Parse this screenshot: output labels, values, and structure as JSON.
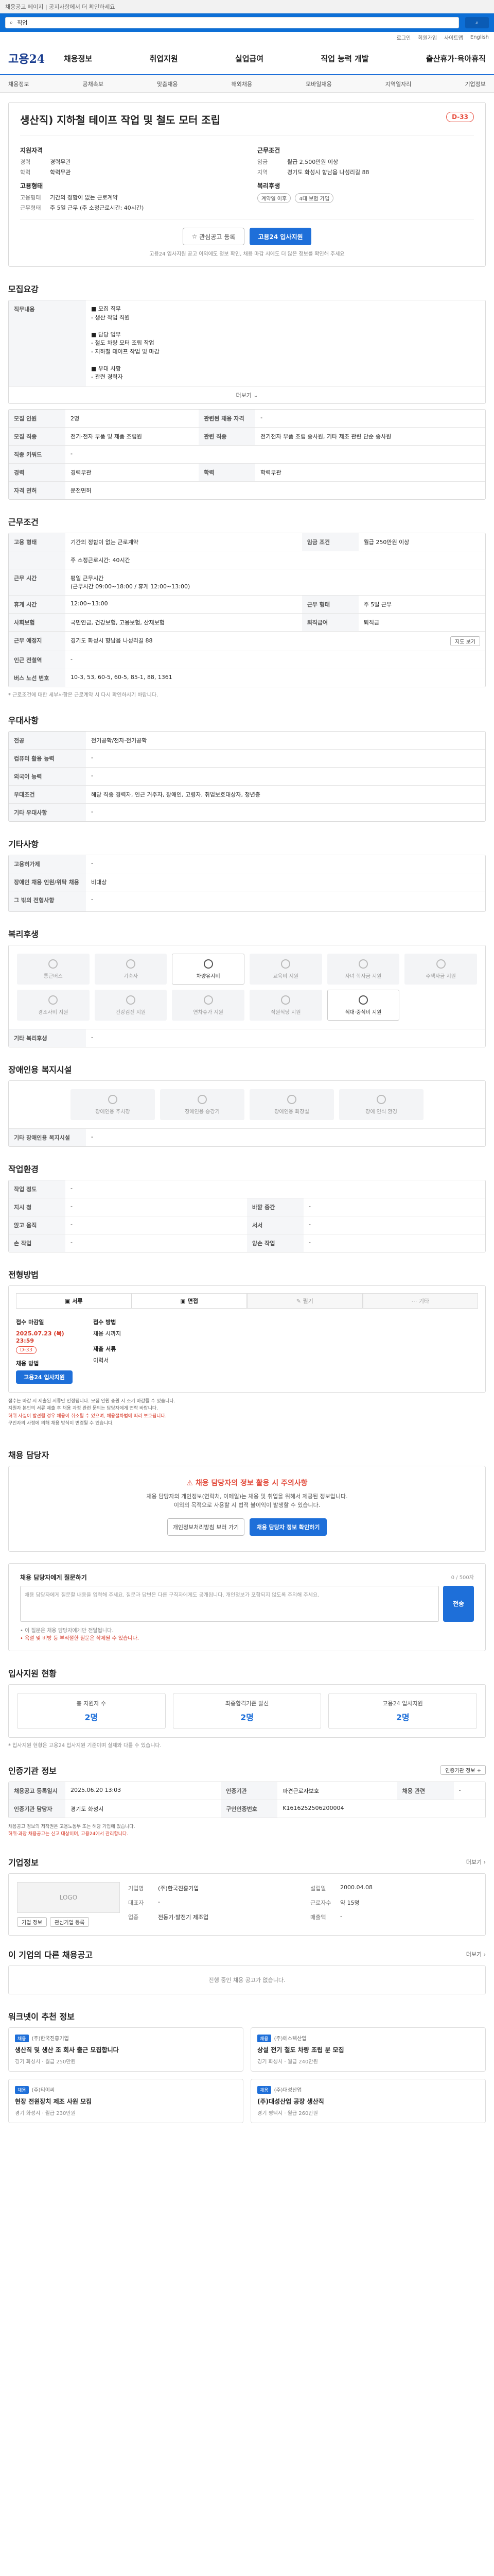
{
  "top": {
    "notice": "채용공고 페이지 | 공지사항에서 더 확인하세요"
  },
  "search": {
    "value": "직업"
  },
  "subnav": [
    "로그인",
    "회원가입",
    "사이트맵",
    "English"
  ],
  "logo": "고용24",
  "gnb": [
    "채용정보",
    "취업지원",
    "실업급여",
    "직업 능력 개발",
    "출산휴가·육아휴직"
  ],
  "lnb": [
    "채용정보",
    "공채속보",
    "맞춤채용",
    "해외채용",
    "모바일채용",
    "지역일자리",
    "기업정보"
  ],
  "job": {
    "title": "생산직) 지하철 테이프 작업 및 철도 모터 조립",
    "dday": "D-33",
    "left": {
      "title": "지원자격",
      "rows": [
        [
          "경력",
          "경력무관"
        ],
        [
          "학력",
          "학력무관"
        ]
      ],
      "title2": "고용형태",
      "rows2": [
        [
          "고용형태",
          "기간의 정함이 없는 근로계약"
        ],
        [
          "근무형태",
          "주 5일 근무 (주 소정근로시간: 40시간)"
        ]
      ]
    },
    "right": {
      "title": "근무조건",
      "rows": [
        [
          "임금",
          "월급 2,500만원 이상"
        ],
        [
          "지역",
          "경기도 화성시 향남읍 나성리길 88"
        ]
      ],
      "title2": "복리후생",
      "tags": [
        "계약일 이후",
        "4대 보험 가입"
      ]
    },
    "btn_interest": "관심공고 등록",
    "btn_apply": "고용24 입사지원",
    "note": "고용24 입사지원 공고 이외에도 정보 확인, 채용 마감 시에도 더 많은 정보를 확인해 주세요"
  },
  "apply": {
    "heading": "모집요강",
    "rows": [
      [
        "직무내용",
        "■ 모집 직무\n- 생산 작업 직원\n\n■ 담당 업무\n- 철도 차량 모터 조립 작업\n- 지하철 테이프 작업 및 마감\n\n■ 우대 사항\n- 관련 경력자"
      ]
    ],
    "more": "더보기",
    "grid": [
      [
        "모집 인원",
        "2명",
        "관련된 채용 자격",
        "-"
      ],
      [
        "모집 직종",
        "전기·전자 부품 및 제품 조립원",
        "관련 직종",
        "전기전자 부품 조립 종사원, 기타 제조 관련 단순 종사원"
      ],
      [
        "직종 키워드",
        "-",
        "",
        ""
      ],
      [
        "경력",
        "경력무관",
        "학력",
        "학력무관"
      ],
      [
        "자격 면허",
        "운전면허",
        "",
        ""
      ]
    ]
  },
  "work": {
    "heading": "근무조건",
    "rows": [
      [
        "고용 형태",
        "기간의 정함이 없는 근로계약",
        "임금 조건",
        "월급 250만원 이상"
      ],
      [
        "",
        "주 소정근로시간: 40시간",
        "",
        ""
      ],
      [
        "근무 시간",
        "평일 근무시간\n(근무시간 09:00~18:00 / 휴게 12:00~13:00)",
        "",
        ""
      ],
      [
        "휴게 시간",
        "12:00~13:00",
        "근무 형태",
        "주 5일 근무"
      ],
      [
        "사회보험",
        "국민연금, 건강보험, 고용보험, 산재보험",
        "퇴직급여",
        "퇴직금"
      ],
      [
        "근무 예정지",
        "경기도 화성시 향남읍 나성리길 88",
        "",
        ""
      ],
      [
        "인근 전철역",
        "-",
        "",
        ""
      ],
      [
        "버스 노선 번호",
        "10-3, 53, 60-5, 60-5, 85-1, 88, 1361",
        "",
        ""
      ]
    ],
    "map_btn": "지도 보기",
    "note": "* 근로조건에 대한 세부사항은 근로계약 시 다시 확인하시기 바랍니다."
  },
  "prefer": {
    "heading": "우대사항",
    "rows": [
      [
        "전공",
        "전기공학/전자·전기공학"
      ],
      [
        "컴퓨터 활용 능력",
        "-"
      ],
      [
        "외국어 능력",
        "-"
      ],
      [
        "우대조건",
        "해당 직종 경력자, 인근 거주자, 장애인, 고령자, 취업보호대상자, 청년층"
      ],
      [
        "기타 우대사항",
        "-"
      ]
    ]
  },
  "etc": {
    "heading": "기타사항",
    "rows": [
      [
        "고용허가제",
        "-"
      ],
      [
        "장애인 채용 인원/위탁 채용",
        "비대상"
      ],
      [
        "그 밖의 전형사항",
        "-"
      ]
    ]
  },
  "welfare": {
    "heading": "복리후생",
    "items": [
      "통근버스",
      "기숙사",
      "차량유지비",
      "교육비 지원",
      "자녀 학자금 지원",
      "주택자금 지원",
      "경조사비 지원",
      "건강검진 지원",
      "연차휴가 지원",
      "직원식당 지원",
      "식대·중식비 지원"
    ],
    "active": [
      2,
      10
    ],
    "other_label": "기타 복리후생",
    "other": "-"
  },
  "disabled": {
    "heading": "장애인용 복지시설",
    "items": [
      "장애인용 주차장",
      "장애인용 승강기",
      "장애인용 화장실",
      "장애 인식 환경"
    ],
    "other_label": "기타 장애인용 복지시설",
    "other": "-"
  },
  "env": {
    "heading": "작업환경",
    "rows": [
      [
        "작업 정도",
        "-",
        "",
        ""
      ],
      [
        "지시 청",
        "-",
        "바깥 중간",
        "-"
      ],
      [
        "앉고 움직",
        "-",
        "서서",
        "-"
      ],
      [
        "손 작업",
        "-",
        "양손 작업",
        "-"
      ]
    ]
  },
  "screen": {
    "heading": "전형방법",
    "steps": [
      "서류",
      "면접",
      "필기",
      "기타"
    ],
    "deadline_label": "접수 마감일",
    "deadline": "2025.07.23 (목) 23:59",
    "dday": "D-33",
    "apply_label": "채용 방법",
    "apply_btn": "고용24 입사지원",
    "method_label": "접수 방법",
    "method": "채용 시까지",
    "docs_label": "제출 서류",
    "docs": "이력서",
    "notes": [
      "접수는 마감 시 제출된 서류만 인정됩니다. 모집 인원 충원 시 조기 마감될 수 있습니다.",
      "지원자 본인의 서류 제출 후 채용 과정 관련 문의는 담당자에게 연락 바랍니다.",
      "허위 사실이 발견될 경우 채용이 취소될 수 있으며, 채용절차법에 따라 보호됩니다.",
      "구인자의 사정에 의해 채용 방식이 변경될 수 있습니다."
    ]
  },
  "contact": {
    "heading": "채용 담당자",
    "warn_title": "채용 담당자의 정보 활용 시 주의사항",
    "warn_body": "채용 담당자의 개인정보(연락처, 이메일)는 채용 및 취업을 위해서 제공된 정보입니다.\n이외의 목적으로 사용할 시 법적 불이익이 발생할 수 있습니다.",
    "btn1": "개인정보처리방침 보러 가기",
    "btn2": "채용 담당자 정보 확인하기"
  },
  "ask": {
    "heading": "채용 담당자에게 질문하기",
    "hint": "0 / 500자",
    "placeholder": "채용 담당자에게 질문할 내용을 입력해 주세요. 질문과 답변은 다른 구직자에게도 공개됩니다. 개인정보가 포함되지 않도록 주의해 주세요.",
    "btn": "전송",
    "notes": [
      "• 이 질문은 채용 담당자에게만 전달됩니다.",
      "• 욕설 및 비방 등 부적절한 질문은 삭제될 수 있습니다."
    ]
  },
  "status": {
    "heading": "입사지원 현황",
    "items": [
      [
        "총 지원자 수",
        "2명"
      ],
      [
        "최종합격기준 발신",
        "2명"
      ],
      [
        "고용24 입사지원",
        "2명"
      ]
    ],
    "note": "* 입사지원 현황은 고용24 입사지원 기준이며 실제와 다를 수 있습니다."
  },
  "info": {
    "heading": "인증기관 정보",
    "btn": "인증기관 정보 +",
    "rows": [
      [
        "채용공고 등록일시",
        "2025.06.20 13:03",
        "인증기관",
        "파견근로자보호",
        "채용 관련",
        "-"
      ],
      [
        "인증기관 담당자",
        "경기도 화성시",
        "구인인증번호",
        "K1616252506200004",
        "",
        ""
      ]
    ],
    "notes": [
      "채용공고 정보의 저작권은 고용노동부 또는 해당 기업에 있습니다.",
      "허위·과장 채용공고는 신고 대상이며, 고용24에서 관리합니다."
    ]
  },
  "company": {
    "heading": "기업정보",
    "more": "더보기",
    "logo": "LOGO",
    "btn1": "기업 정보",
    "btn2": "관심기업 등록",
    "rows": [
      [
        "기업명",
        "(주)한국진흥기업"
      ],
      [
        "대표자",
        "-"
      ],
      [
        "업종",
        "전동기·발전기 제조업"
      ],
      [
        "설립일",
        "2000.04.08"
      ],
      [
        "근로자수",
        "약 15명"
      ],
      [
        "매출액",
        "-"
      ]
    ]
  },
  "related": {
    "heading": "이 기업의 다른 채용공고",
    "more": "더보기",
    "empty": "진행 중인 채용 공고가 없습니다."
  },
  "sugg": {
    "heading": "워크넷이 추천 정보",
    "items": [
      {
        "badge": "채용",
        "co": "(주)한국진흥기업",
        "title": "생산직 및 생산 조 회사 출근 모집합니다",
        "meta": "경기 화성시 · 월급 250만원"
      },
      {
        "badge": "채용",
        "co": "(주)에스텍산업",
        "title": "상설 전기 철도 차량 조립 분 모집",
        "meta": "경기 화성시 · 월급 240만원"
      },
      {
        "badge": "채용",
        "co": "(주)티이씨",
        "title": "현장 전원장치 제조 사원 모집",
        "meta": "경기 화성시 · 월급 230만원"
      },
      {
        "badge": "채용",
        "co": "(주)대성산업",
        "title": "(주)대성산업 공장 생산직",
        "meta": "경기 평택시 · 월급 260만원"
      }
    ]
  }
}
